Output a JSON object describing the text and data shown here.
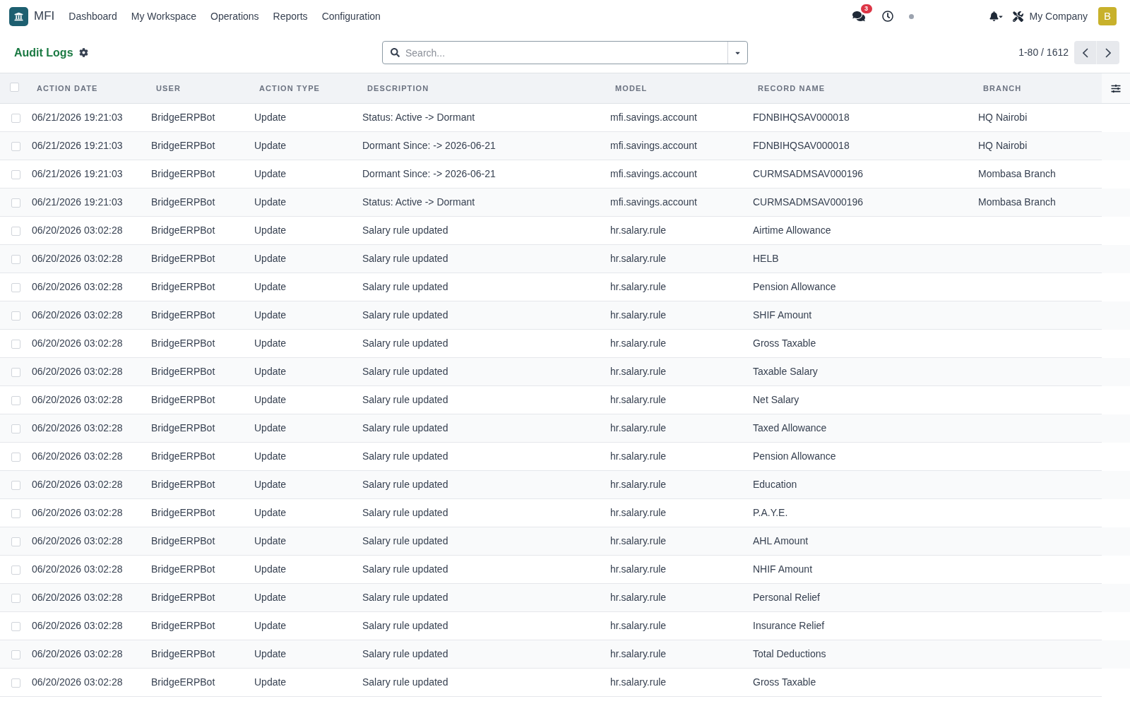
{
  "navbar": {
    "app_name": "MFI",
    "menu": [
      "Dashboard",
      "My Workspace",
      "Operations",
      "Reports",
      "Configuration"
    ],
    "messages_badge": "3",
    "company": "My Company",
    "avatar_initial": "B"
  },
  "control_panel": {
    "title": "Audit Logs",
    "search": {
      "placeholder": "Search..."
    },
    "pager": "1-80 / 1612"
  },
  "table": {
    "select_all": {
      "checked": false
    },
    "columns": [
      "ACTION DATE",
      "USER",
      "ACTION TYPE",
      "DESCRIPTION",
      "MODEL",
      "RECORD NAME",
      "BRANCH"
    ],
    "rows": [
      {
        "checked": false,
        "action_date": "06/21/2026 19:21:03",
        "user": "BridgeERPBot",
        "action_type": "Update",
        "description": "Status: Active -> Dormant",
        "model": "mfi.savings.account",
        "record_name": "FDNBIHQSAV000018",
        "branch": "HQ Nairobi"
      },
      {
        "checked": false,
        "action_date": "06/21/2026 19:21:03",
        "user": "BridgeERPBot",
        "action_type": "Update",
        "description": "Dormant Since: -> 2026-06-21",
        "model": "mfi.savings.account",
        "record_name": "FDNBIHQSAV000018",
        "branch": "HQ Nairobi"
      },
      {
        "checked": false,
        "action_date": "06/21/2026 19:21:03",
        "user": "BridgeERPBot",
        "action_type": "Update",
        "description": "Dormant Since: -> 2026-06-21",
        "model": "mfi.savings.account",
        "record_name": "CURMSADMSAV000196",
        "branch": "Mombasa Branch"
      },
      {
        "checked": false,
        "action_date": "06/21/2026 19:21:03",
        "user": "BridgeERPBot",
        "action_type": "Update",
        "description": "Status: Active -> Dormant",
        "model": "mfi.savings.account",
        "record_name": "CURMSADMSAV000196",
        "branch": "Mombasa Branch"
      },
      {
        "checked": false,
        "action_date": "06/20/2026 03:02:28",
        "user": "BridgeERPBot",
        "action_type": "Update",
        "description": "Salary rule updated",
        "model": "hr.salary.rule",
        "record_name": "Airtime Allowance"
      },
      {
        "checked": false,
        "action_date": "06/20/2026 03:02:28",
        "user": "BridgeERPBot",
        "action_type": "Update",
        "description": "Salary rule updated",
        "model": "hr.salary.rule",
        "record_name": "HELB"
      },
      {
        "checked": false,
        "action_date": "06/20/2026 03:02:28",
        "user": "BridgeERPBot",
        "action_type": "Update",
        "description": "Salary rule updated",
        "model": "hr.salary.rule",
        "record_name": "Pension Allowance"
      },
      {
        "checked": false,
        "action_date": "06/20/2026 03:02:28",
        "user": "BridgeERPBot",
        "action_type": "Update",
        "description": "Salary rule updated",
        "model": "hr.salary.rule",
        "record_name": "SHIF Amount"
      },
      {
        "checked": false,
        "action_date": "06/20/2026 03:02:28",
        "user": "BridgeERPBot",
        "action_type": "Update",
        "description": "Salary rule updated",
        "model": "hr.salary.rule",
        "record_name": "Gross Taxable"
      },
      {
        "checked": false,
        "action_date": "06/20/2026 03:02:28",
        "user": "BridgeERPBot",
        "action_type": "Update",
        "description": "Salary rule updated",
        "model": "hr.salary.rule",
        "record_name": "Taxable Salary"
      },
      {
        "checked": false,
        "action_date": "06/20/2026 03:02:28",
        "user": "BridgeERPBot",
        "action_type": "Update",
        "description": "Salary rule updated",
        "model": "hr.salary.rule",
        "record_name": "Net Salary"
      },
      {
        "checked": false,
        "action_date": "06/20/2026 03:02:28",
        "user": "BridgeERPBot",
        "action_type": "Update",
        "description": "Salary rule updated",
        "model": "hr.salary.rule",
        "record_name": "Taxed Allowance"
      },
      {
        "checked": false,
        "action_date": "06/20/2026 03:02:28",
        "user": "BridgeERPBot",
        "action_type": "Update",
        "description": "Salary rule updated",
        "model": "hr.salary.rule",
        "record_name": "Pension Allowance"
      },
      {
        "checked": false,
        "action_date": "06/20/2026 03:02:28",
        "user": "BridgeERPBot",
        "action_type": "Update",
        "description": "Salary rule updated",
        "model": "hr.salary.rule",
        "record_name": "Education"
      },
      {
        "checked": false,
        "action_date": "06/20/2026 03:02:28",
        "user": "BridgeERPBot",
        "action_type": "Update",
        "description": "Salary rule updated",
        "model": "hr.salary.rule",
        "record_name": "P.A.Y.E."
      },
      {
        "checked": false,
        "action_date": "06/20/2026 03:02:28",
        "user": "BridgeERPBot",
        "action_type": "Update",
        "description": "Salary rule updated",
        "model": "hr.salary.rule",
        "record_name": "AHL Amount"
      },
      {
        "checked": false,
        "action_date": "06/20/2026 03:02:28",
        "user": "BridgeERPBot",
        "action_type": "Update",
        "description": "Salary rule updated",
        "model": "hr.salary.rule",
        "record_name": "NHIF Amount"
      },
      {
        "checked": false,
        "action_date": "06/20/2026 03:02:28",
        "user": "BridgeERPBot",
        "action_type": "Update",
        "description": "Salary rule updated",
        "model": "hr.salary.rule",
        "record_name": "Personal Relief"
      },
      {
        "checked": false,
        "action_date": "06/20/2026 03:02:28",
        "user": "BridgeERPBot",
        "action_type": "Update",
        "description": "Salary rule updated",
        "model": "hr.salary.rule",
        "record_name": "Insurance Relief"
      },
      {
        "checked": false,
        "action_date": "06/20/2026 03:02:28",
        "user": "BridgeERPBot",
        "action_type": "Update",
        "description": "Salary rule updated",
        "model": "hr.salary.rule",
        "record_name": "Total Deductions"
      },
      {
        "checked": false,
        "action_date": "06/20/2026 03:02:28",
        "user": "BridgeERPBot",
        "action_type": "Update",
        "description": "Salary rule updated",
        "model": "hr.salary.rule",
        "record_name": "Gross Taxable"
      }
    ]
  }
}
